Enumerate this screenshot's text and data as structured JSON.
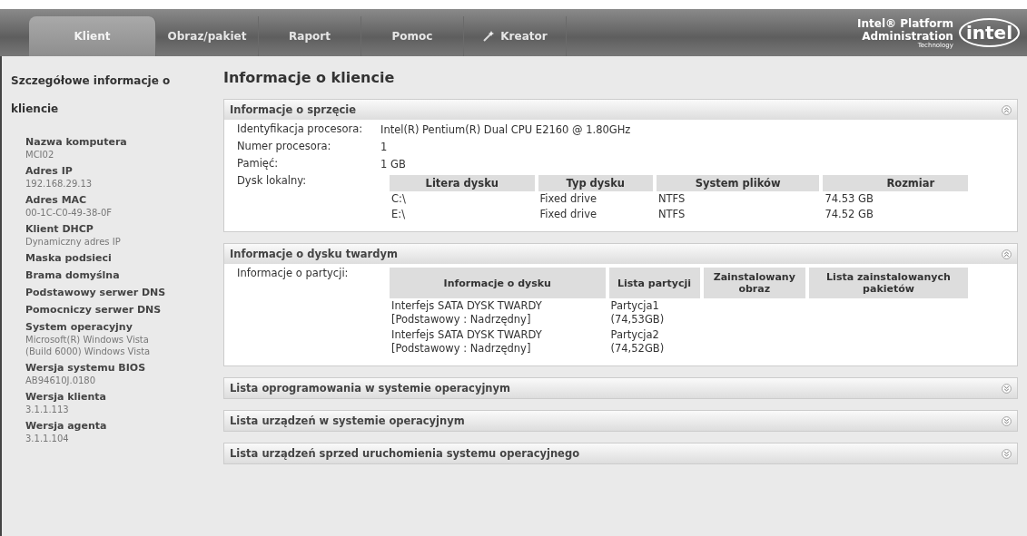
{
  "tabs": [
    {
      "label": "Klient",
      "selected": true,
      "icon": false
    },
    {
      "label": "Obraz/pakiet",
      "selected": false,
      "icon": false
    },
    {
      "label": "Raport",
      "selected": false,
      "icon": false
    },
    {
      "label": "Pomoc",
      "selected": false,
      "icon": false
    },
    {
      "label": "Kreator",
      "selected": false,
      "icon": true
    }
  ],
  "logo": {
    "line1": "Intel® Platform",
    "line2": "Administration",
    "line3": "Technology",
    "mark": "intel"
  },
  "sidebar": {
    "title": "Szczegółowe informacje o kliencie",
    "items": [
      {
        "label": "Nazwa komputera",
        "value": [
          "MCI02"
        ]
      },
      {
        "label": "Adres IP",
        "value": [
          "192.168.29.13"
        ]
      },
      {
        "label": "Adres MAC",
        "value": [
          "00-1C-C0-49-38-0F"
        ]
      },
      {
        "label": "Klient DHCP",
        "value": [
          "Dynamiczny adres IP"
        ]
      },
      {
        "label": "Maska podsieci",
        "value": []
      },
      {
        "label": "Brama domyślna",
        "value": []
      },
      {
        "label": "Podstawowy serwer DNS",
        "value": []
      },
      {
        "label": "Pomocniczy serwer DNS",
        "value": []
      },
      {
        "label": "System operacyjny",
        "value": [
          "Microsoft(R) Windows Vista",
          "(Build 6000) Windows Vista"
        ]
      },
      {
        "label": "Wersja systemu BIOS",
        "value": [
          "AB94610J.0180"
        ]
      },
      {
        "label": "Wersja klienta",
        "value": [
          "3.1.1.113"
        ]
      },
      {
        "label": "Wersja agenta",
        "value": [
          "3.1.1.104"
        ]
      }
    ]
  },
  "page_title": "Informacje o kliencie",
  "sections": [
    {
      "title": "Informacje o sprzęcie",
      "expanded": true,
      "kind": "hardware",
      "fields": [
        {
          "label": "Identyfikacja procesora:",
          "value": "Intel(R) Pentium(R) Dual CPU E2160 @ 1.80GHz"
        },
        {
          "label": "Numer procesora:",
          "value": "1"
        },
        {
          "label": "Pamięć:",
          "value": "1 GB"
        }
      ],
      "table_label": "Dysk lokalny:",
      "columns": [
        "Litera dysku",
        "Typ dysku",
        "System plików",
        "Rozmiar"
      ],
      "rows": [
        [
          "C:\\",
          "Fixed drive",
          "NTFS",
          "74.53 GB"
        ],
        [
          "E:\\",
          "Fixed drive",
          "NTFS",
          "74.52 GB"
        ]
      ]
    },
    {
      "title": "Informacje o dysku twardym",
      "expanded": true,
      "kind": "disk",
      "table_label": "Informacje o partycji:",
      "columns": [
        "Informacje o dysku",
        "Lista partycji",
        "Zainstalowany obraz",
        "Lista zainstalowanych pakietów"
      ],
      "rows": [
        [
          "Interfejs SATA DYSK TWARDY [Podstawowy : Nadrzędny]",
          "Partycja1 (74,53GB)"
        ],
        [
          "Interfejs SATA DYSK TWARDY [Podstawowy : Nadrzędny]",
          "Partycja2 (74,52GB)"
        ]
      ]
    },
    {
      "title": "Lista oprogramowania w systemie operacyjnym",
      "expanded": false
    },
    {
      "title": "Lista urządzeń w systemie operacyjnym",
      "expanded": false
    },
    {
      "title": "Lista urządzeń sprzed uruchomienia systemu operacyjnego",
      "expanded": false
    }
  ]
}
